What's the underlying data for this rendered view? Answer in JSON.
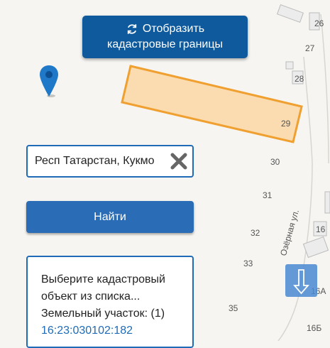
{
  "cadastral_button": {
    "line1": "Отобразить",
    "line2": "кадастровые границы",
    "icon": "refresh-icon"
  },
  "search": {
    "value": "Респ Татарстан, Кукмо",
    "clear_icon": "close-icon"
  },
  "find_button": {
    "label": "Найти"
  },
  "result_panel": {
    "line1": "Выберите кадастровый",
    "line2": "объект из списка...",
    "line3": "Земельный участок: (1)",
    "cadastral_number": "16:23:030102:182"
  },
  "map": {
    "street_name": "Озёрная ул.",
    "house_numbers": {
      "n26": "26",
      "n27": "27",
      "n28": "28",
      "n29": "29",
      "n30": "30",
      "n31": "31",
      "n32": "32",
      "n33": "33",
      "n35": "35",
      "n16": "16",
      "n16a": "16А",
      "n16b": "16Б"
    },
    "parcel_color": "#f0a030",
    "parcel_fill": "#fbdcb0"
  },
  "scroll_button": {
    "icon": "arrow-down-icon"
  },
  "colors": {
    "primary": "#0e5a9c",
    "button": "#2a6cb5",
    "pin": "#1f78c8"
  }
}
